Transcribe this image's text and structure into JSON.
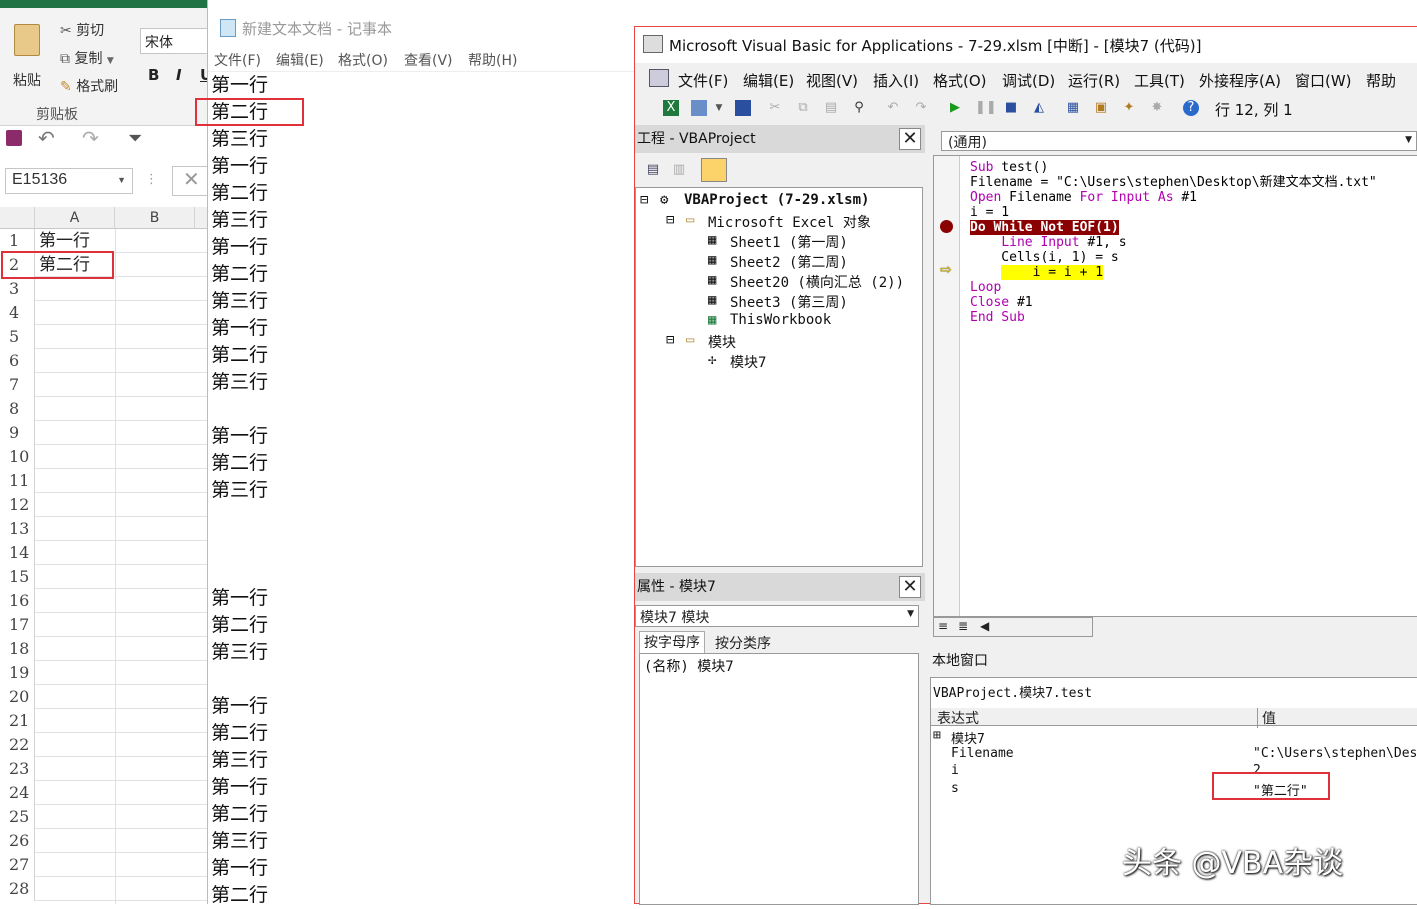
{
  "excel": {
    "ribbon": {
      "paste": "粘贴",
      "cut": "剪切",
      "copy": "复制",
      "format_painter": "格式刷",
      "clipboard_group": "剪贴板",
      "font_name": "宋体",
      "bold": "B",
      "italic": "I",
      "underline": "U"
    },
    "name_box": "E15136",
    "columns": [
      "A",
      "B"
    ],
    "rows": [
      "1",
      "2",
      "3",
      "4",
      "5",
      "6",
      "7",
      "8",
      "9",
      "10",
      "11",
      "12",
      "13",
      "14",
      "15",
      "16",
      "17",
      "18",
      "19",
      "20",
      "21",
      "22",
      "23",
      "24",
      "25",
      "26",
      "27",
      "28"
    ],
    "cells": {
      "A1": "第一行",
      "A2": "第二行"
    }
  },
  "notepad": {
    "title": "新建文本文档 - 记事本",
    "menu": [
      "文件(F)",
      "编辑(E)",
      "格式(O)",
      "查看(V)",
      "帮助(H)"
    ],
    "lines": [
      "第一行",
      "第二行",
      "第三行",
      "第一行",
      "第二行",
      "第三行",
      "第一行",
      "第二行",
      "第三行",
      "第一行",
      "第二行",
      "第三行",
      "",
      "第一行",
      "第二行",
      "第三行",
      "",
      "",
      "",
      "第一行",
      "第二行",
      "第三行",
      "",
      "第一行",
      "第二行",
      "第三行",
      "第一行",
      "第二行",
      "第三行",
      "第一行",
      "第二行"
    ]
  },
  "vba": {
    "title": "Microsoft Visual Basic for Applications - 7-29.xlsm [中断] - [模块7 (代码)]",
    "menu": [
      "文件(F)",
      "编辑(E)",
      "视图(V)",
      "插入(I)",
      "格式(O)",
      "调试(D)",
      "运行(R)",
      "工具(T)",
      "外接程序(A)",
      "窗口(W)",
      "帮助(H)"
    ],
    "cursor_pos": "行 12, 列 1",
    "project": {
      "title": "工程 - VBAProject",
      "root": "VBAProject (7-29.xlsm)",
      "excel_objects": "Microsoft Excel 对象",
      "sheets": [
        "Sheet1 (第一周)",
        "Sheet2 (第二周)",
        "Sheet20 (横向汇总 (2))",
        "Sheet3 (第三周)",
        "ThisWorkbook"
      ],
      "modules_folder": "模块",
      "module": "模块7"
    },
    "properties": {
      "title": "属性 - 模块7",
      "object": "模块7 模块",
      "tab_alpha": "按字母序",
      "tab_category": "按分类序",
      "name_row": "(名称) 模块7"
    },
    "code": {
      "proc_combo": "(通用)",
      "lines": [
        "Sub test()",
        "Filename = \"C:\\Users\\stephen\\Desktop\\新建文本文档.txt\"",
        "Open Filename For Input As #1",
        "i = 1",
        "Do While Not EOF(1)",
        "    Line Input #1, s",
        "    Cells(i, 1) = s",
        "    i = i + 1",
        "Loop",
        "Close #1",
        "End Sub"
      ]
    },
    "locals": {
      "title": "本地窗口",
      "context": "VBAProject.模块7.test",
      "col_expr": "表达式",
      "col_value": "值",
      "rows": [
        {
          "expr": "模块7",
          "value": ""
        },
        {
          "expr": "Filename",
          "value": "\"C:\\Users\\stephen\\Des"
        },
        {
          "expr": "i",
          "value": "2"
        },
        {
          "expr": "s",
          "value": "\"第二行\""
        }
      ]
    }
  },
  "watermark": "头条 @VBA杂谈"
}
